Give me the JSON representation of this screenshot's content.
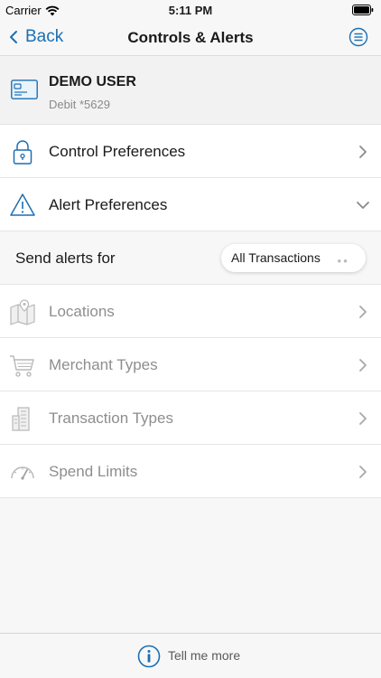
{
  "status_bar": {
    "carrier": "Carrier",
    "time": "5:11 PM"
  },
  "nav": {
    "back_label": "Back",
    "title": "Controls & Alerts",
    "menu_icon": "list-circle-icon"
  },
  "account": {
    "name": "DEMO USER",
    "number": "Debit *5629",
    "icon": "card-icon"
  },
  "control_preferences": {
    "label": "Control Preferences",
    "icon": "lock-icon"
  },
  "alert_preferences": {
    "label": "Alert Preferences",
    "icon": "warning-icon"
  },
  "send_alerts": {
    "label": "Send alerts for",
    "selected": "All Transactions"
  },
  "alert_items": [
    {
      "label": "Locations",
      "icon": "map-pin-icon"
    },
    {
      "label": "Merchant Types",
      "icon": "cart-icon"
    },
    {
      "label": "Transaction Types",
      "icon": "buildings-icon"
    },
    {
      "label": "Spend Limits",
      "icon": "gauge-icon"
    }
  ],
  "footer": {
    "label": "Tell me more",
    "icon": "info-icon"
  },
  "colors": {
    "accent": "#1b6fb3",
    "background": "#f7f7f7",
    "dim_text": "#8e8e8e"
  }
}
